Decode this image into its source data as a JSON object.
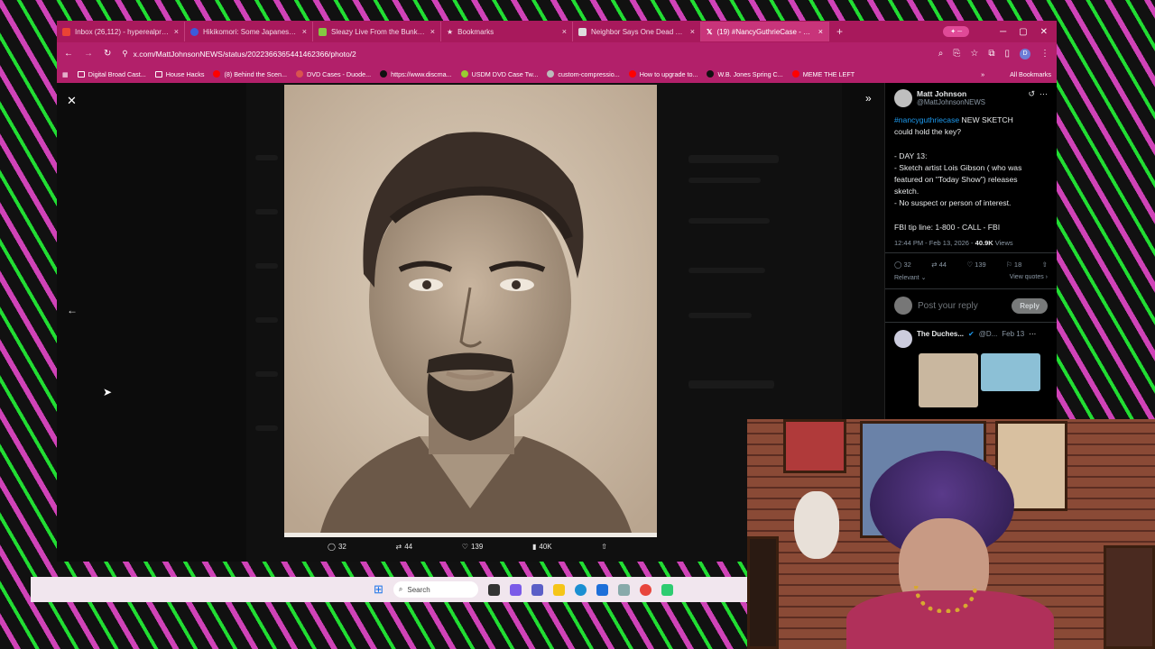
{
  "tabs": [
    {
      "title": "Inbox (26,112) - hyperealprodu...",
      "icon": "gmail-icon",
      "color": "#ea4335",
      "active": false
    },
    {
      "title": "Hikikomori: Some Japanese Fil...",
      "icon": "site-icon",
      "color": "#3b5bdb",
      "active": false
    },
    {
      "title": "Sleazy Live From the Bunker 2/...",
      "icon": "rumble-icon",
      "color": "#85c742",
      "active": false
    },
    {
      "title": "Bookmarks",
      "icon": "star-icon",
      "color": "#ffffff",
      "active": false
    },
    {
      "title": "Neighbor Says One Dead and T...",
      "icon": "news-icon",
      "color": "#dddddd",
      "active": false
    },
    {
      "title": "(19) #NancyGuthrieCase - Sear...",
      "icon": "x-icon",
      "color": "#000000",
      "active": true
    }
  ],
  "url": "x.com/MattJohnsonNEWS/status/2022366365441462366/photo/2",
  "bookmarks": [
    {
      "label": "Digital Broad Cast...",
      "type": "folder"
    },
    {
      "label": "House Hacks",
      "type": "folder"
    },
    {
      "label": "(8) Behind the Scen...",
      "type": "site"
    },
    {
      "label": "DVD Cases - Duode...",
      "type": "site"
    },
    {
      "label": "https://www.discma...",
      "type": "site"
    },
    {
      "label": "USDM DVD Case Tw...",
      "type": "site"
    },
    {
      "label": "custom-compressio...",
      "type": "site"
    },
    {
      "label": "How to upgrade to...",
      "type": "site"
    },
    {
      "label": "W.B. Jones Spring C...",
      "type": "site"
    },
    {
      "label": "MEME THE LEFT",
      "type": "site"
    }
  ],
  "all_bookmarks": "All Bookmarks",
  "photo_actions": {
    "replies": "32",
    "reposts": "44",
    "likes": "139",
    "views": "40K"
  },
  "tweet": {
    "name": "Matt Johnson",
    "handle": "@MattJohnsonNEWS",
    "hashtag": "#nancyguthriecase",
    "line1_rest": " NEW SKETCH",
    "line2": "could hold the key?",
    "line3": "",
    "line4": "- DAY 13:",
    "line5": "- Sketch artist Lois Gibson ( who was",
    "line6": "featured on \"Today Show\") releases",
    "line7": "sketch.",
    "line8": "- No suspect or person of interest.",
    "line9": "",
    "line10": "FBI tip line: 1-800 - CALL - FBI",
    "time": "12:44 PM - Feb 13, 2026 -",
    "views": "40.9K",
    "views_label": " Views",
    "stats": {
      "replies": "32",
      "reposts": "44",
      "likes": "139",
      "bookmarks": "18"
    },
    "sort": "Relevant",
    "view_quotes": "View quotes",
    "reply_placeholder": "Post your reply",
    "reply_button": "Reply",
    "next_name": "The Duches...",
    "next_handle": "@D...",
    "next_date": "Feb 13"
  },
  "taskbar": {
    "search_placeholder": "Search"
  }
}
